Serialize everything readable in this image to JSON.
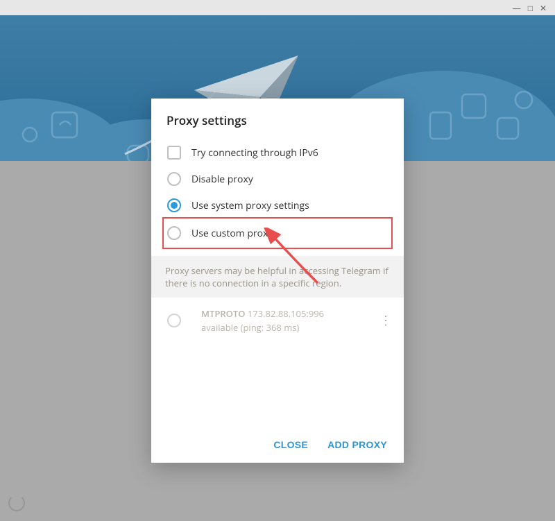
{
  "window": {
    "controls": {
      "minimize": "—",
      "maximize": "□",
      "close": "✕"
    }
  },
  "modal": {
    "title": "Proxy settings",
    "options": {
      "ipv6_label": "Try connecting through IPv6",
      "disable_label": "Disable proxy",
      "system_label": "Use system proxy settings",
      "custom_label": "Use custom proxy",
      "selected": "system"
    },
    "info_text": "Proxy servers may be helpful in accessing Telegram if there is no connection in a specific region.",
    "proxy": {
      "protocol": "MTPROTO",
      "address": "173.82.88.105:996",
      "status": "available (ping: 368 ms)"
    },
    "buttons": {
      "close": "CLOSE",
      "add": "ADD PROXY"
    }
  },
  "annotation": {
    "highlight_target": "custom",
    "arrow_color": "#e84e4e"
  }
}
